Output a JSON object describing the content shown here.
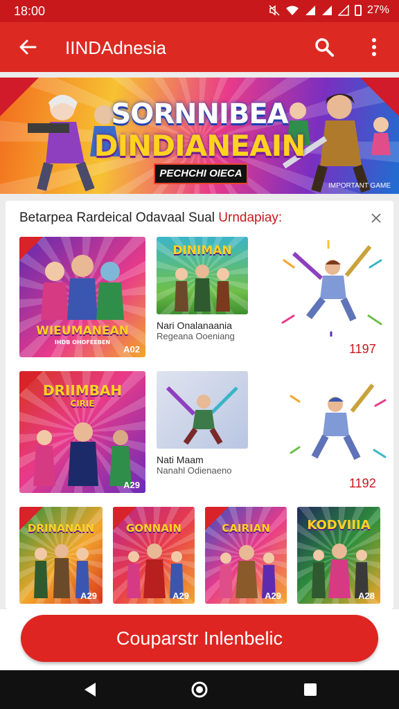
{
  "status_bar": {
    "time": "18:00",
    "battery": "27%",
    "icons": [
      "mute-icon",
      "wifi-icon",
      "signal-icon",
      "signal-icon",
      "signal-icon",
      "battery-icon"
    ]
  },
  "app_bar": {
    "title": "IINDAdnesia",
    "back_icon": "arrow-left-icon",
    "search_icon": "search-icon",
    "more_icon": "more-vert-icon"
  },
  "banner": {
    "title_line1": "SORNNIBEA",
    "title_line2": "DINDIANEAIN",
    "tag": "PECHCHI OIECA",
    "credit": "IMPORTANT GAME"
  },
  "panel": {
    "title_main": "Betarpea Rardeical Odavaal Sual",
    "title_accent": "Urndapiay:",
    "close_icon": "close-icon",
    "row1": {
      "tile_a": {
        "title": "WIEUMANEAN",
        "subtitle": "IHDB OHOFEEBEN",
        "number": "A02"
      },
      "tile_b": {
        "title": "DINIMAN"
      },
      "item_name": "Nari Onalanaania",
      "item_sub": "Regeana Ooeniang",
      "price": "1197"
    },
    "row2": {
      "tile_a": {
        "title": "DRIIMBAH",
        "subtitle": "CIRIE",
        "number": "A29"
      },
      "item_name": "Nati Maam",
      "item_sub": "Nanahl Odienaeno",
      "price": "1192"
    },
    "row3": [
      {
        "title": "DRINANAIN",
        "number": "A29"
      },
      {
        "title": "GONNAIN",
        "number": "A29"
      },
      {
        "title": "CAIRIAN",
        "number": "A29"
      },
      {
        "title": "KODVIIIA",
        "number": "A28"
      }
    ]
  },
  "cta": {
    "label": "Couparstr Inlenbelic"
  },
  "nav": {
    "back_icon": "nav-back-icon",
    "home_icon": "nav-home-icon",
    "recents_icon": "nav-recents-icon"
  },
  "colors": {
    "primary": "#dc2a22",
    "status": "#c8181c",
    "accent_text": "#c8181c"
  }
}
